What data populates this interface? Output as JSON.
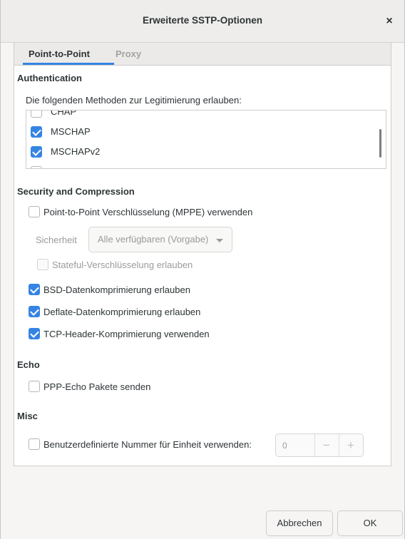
{
  "window": {
    "title": "Erweiterte SSTP-Optionen",
    "close_glyph": "×"
  },
  "tabs": [
    {
      "label": "Point-to-Point",
      "active": true
    },
    {
      "label": "Proxy",
      "active": false
    }
  ],
  "authentication": {
    "title": "Authentication",
    "description": "Die folgenden Methoden zur Legitimierung erlauben:",
    "methods": [
      {
        "label": "CHAP",
        "checked": false
      },
      {
        "label": "MSCHAP",
        "checked": true
      },
      {
        "label": "MSCHAPv2",
        "checked": true
      },
      {
        "label": "",
        "checked": false
      }
    ]
  },
  "security": {
    "title": "Security and Compression",
    "mppe_label": "Point-to-Point Verschlüsselung (MPPE) verwenden",
    "mppe_checked": false,
    "security_label": "Sicherheit",
    "security_value": "Alle verfügbaren (Vorgabe)",
    "stateful_label": "Stateful-Verschlüsselung erlauben",
    "stateful_checked": false,
    "bsd_label": "BSD-Datenkomprimierung erlauben",
    "bsd_checked": true,
    "deflate_label": "Deflate-Datenkomprimierung erlauben",
    "deflate_checked": true,
    "tcp_label": "TCP-Header-Komprimierung verwenden",
    "tcp_checked": true
  },
  "echo": {
    "title": "Echo",
    "ppp_label": "PPP-Echo Pakete senden",
    "ppp_checked": false
  },
  "misc": {
    "title": "Misc",
    "unit_label": "Benutzerdefinierte Nummer für Einheit verwenden:",
    "unit_checked": false,
    "unit_value": "0",
    "minus_glyph": "−",
    "plus_glyph": "+"
  },
  "buttons": {
    "cancel": "Abbrechen",
    "ok": "OK"
  },
  "colors": {
    "accent": "#3584e4",
    "dim_text": "#9a9c99"
  }
}
